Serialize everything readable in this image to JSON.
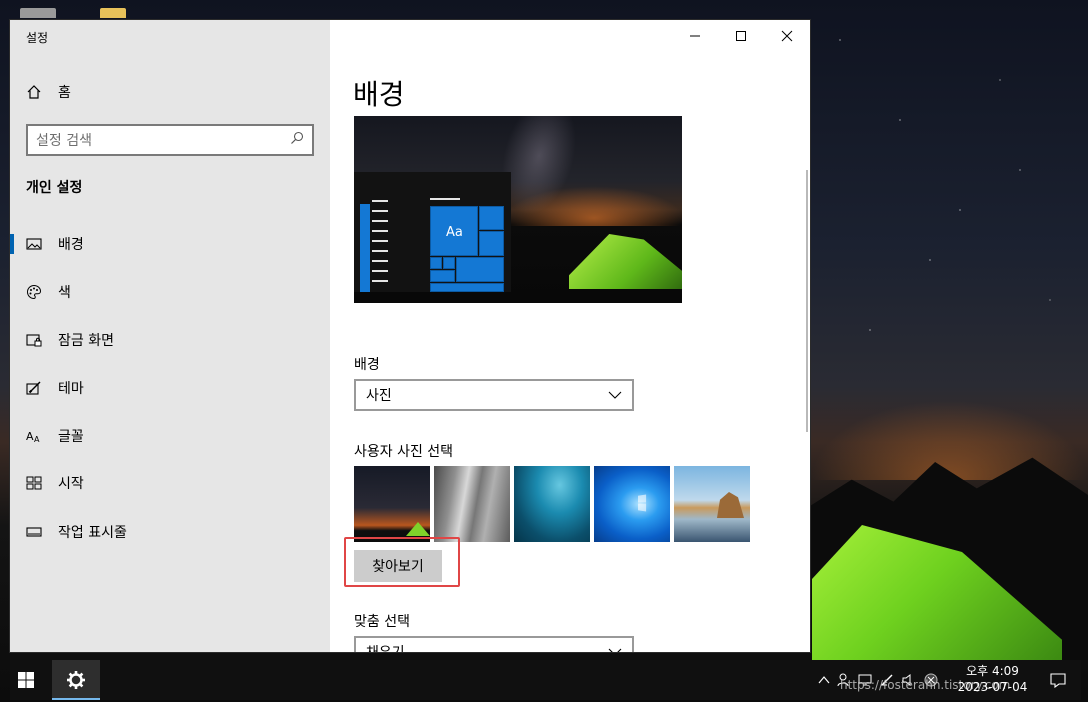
{
  "window": {
    "app_title": "설정",
    "caption": {
      "minimize": "—",
      "maximize": "☐",
      "close": "✕"
    }
  },
  "sidebar": {
    "home_label": "홈",
    "search_placeholder": "설정 검색",
    "section_title": "개인 설정",
    "items": [
      {
        "label": "배경",
        "icon": "picture-icon",
        "active": true
      },
      {
        "label": "색",
        "icon": "palette-icon",
        "active": false
      },
      {
        "label": "잠금 화면",
        "icon": "lock-screen-icon",
        "active": false
      },
      {
        "label": "테마",
        "icon": "theme-brush-icon",
        "active": false
      },
      {
        "label": "글꼴",
        "icon": "font-icon",
        "active": false
      },
      {
        "label": "시작",
        "icon": "start-grid-icon",
        "active": false
      },
      {
        "label": "작업 표시줄",
        "icon": "taskbar-icon",
        "active": false
      }
    ]
  },
  "main": {
    "page_title": "배경",
    "preview": {
      "sample_text": "Aa"
    },
    "background_label": "배경",
    "background_value": "사진",
    "choose_picture_label": "사용자 사진 선택",
    "browse_button": "찾아보기",
    "fit_label": "맞춤 선택",
    "fit_value": "채우기"
  },
  "taskbar": {
    "clock": {
      "time": "오후 4:09",
      "date": "2023-07-04"
    },
    "watermark": "https://fosterahn.tistory.com"
  },
  "colors": {
    "accent": "#0063b1",
    "sidebar_bg": "#e6e6e6",
    "highlight_box": "#e04646",
    "taskbar_bg": "#101010"
  }
}
